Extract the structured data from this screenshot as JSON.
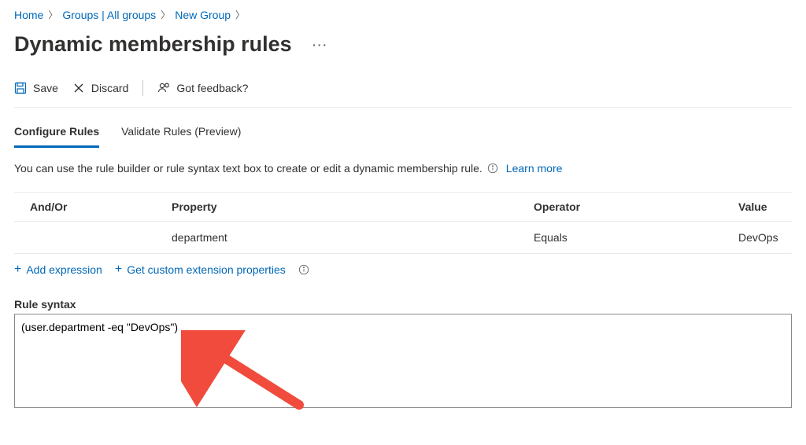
{
  "breadcrumb": {
    "home": "Home",
    "groups": "Groups | All groups",
    "newgroup": "New Group"
  },
  "page": {
    "title": "Dynamic membership rules",
    "ellipsis": "···"
  },
  "toolbar": {
    "save": "Save",
    "discard": "Discard",
    "feedback": "Got feedback?"
  },
  "tabs": {
    "configure": "Configure Rules",
    "validate": "Validate Rules (Preview)"
  },
  "description": {
    "text": "You can use the rule builder or rule syntax text box to create or edit a dynamic membership rule.",
    "learn": "Learn more"
  },
  "table": {
    "headers": {
      "andor": "And/Or",
      "property": "Property",
      "operator": "Operator",
      "value": "Value"
    },
    "row": {
      "andor": "",
      "property": "department",
      "operator": "Equals",
      "value": "DevOps"
    }
  },
  "actions": {
    "add_expression": "Add expression",
    "custom_ext": "Get custom extension properties"
  },
  "syntax": {
    "label": "Rule syntax",
    "value": "(user.department -eq \"DevOps\")"
  }
}
